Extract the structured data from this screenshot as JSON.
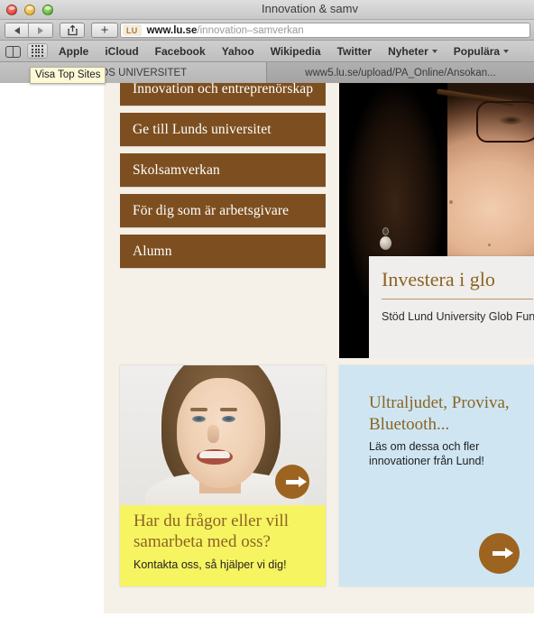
{
  "window": {
    "title": "Innovation & samv",
    "traffic_lights": [
      "close",
      "minimize",
      "zoom"
    ]
  },
  "toolbar": {
    "back_label": "Back",
    "forward_label": "Forward",
    "share_label": "Share",
    "new_tab_label": "+",
    "url_badge": "LU",
    "url_host": "www.lu.se",
    "url_path": "/innovation–samverkan"
  },
  "bookmarks_bar": {
    "sidebar_icon": "book-icon",
    "top_sites_icon": "grid-icon",
    "items": [
      {
        "label": "Apple",
        "has_menu": false
      },
      {
        "label": "iCloud",
        "has_menu": false
      },
      {
        "label": "Facebook",
        "has_menu": false
      },
      {
        "label": "Yahoo",
        "has_menu": false
      },
      {
        "label": "Wikipedia",
        "has_menu": false
      },
      {
        "label": "Twitter",
        "has_menu": false
      },
      {
        "label": "Nyheter",
        "has_menu": true
      },
      {
        "label": "Populära",
        "has_menu": true
      }
    ]
  },
  "tooltip": {
    "text": "Visa Top Sites"
  },
  "tabs": [
    {
      "label": "DS UNIVERSITET",
      "active": true
    },
    {
      "label": "www5.lu.se/upload/PA_Online/Ansokan...",
      "active": false
    }
  ],
  "page": {
    "nav_buttons": [
      {
        "label": "Innovation och entreprenörskap"
      },
      {
        "label": "Ge till Lunds universitet"
      },
      {
        "label": "Skolsamverkan"
      },
      {
        "label": "För dig som är arbetsgivare"
      },
      {
        "label": "Alumn"
      }
    ],
    "photo_card": {
      "caption_title": "Investera i glo",
      "caption_body": "Stöd Lund University Glob Fund"
    },
    "card_yellow": {
      "title": "Har du frågor eller vill samarbeta med oss?",
      "subtitle": "Kontakta oss, så hjälper vi dig!",
      "arrow": "arrow-right-icon"
    },
    "card_blue": {
      "title": "Ultraljudet, Proviva, Bluetooth...",
      "subtitle": "Läs om dessa och fler innovationer från Lund!",
      "arrow": "arrow-right-icon"
    }
  },
  "colors": {
    "nav_button_brown": "#7D4F20",
    "page_cream": "#F5F1E9",
    "card_yellow": "#F7F462",
    "card_blue": "#CFE6F2",
    "heading_gold": "#8A6424",
    "arrow_brown": "#9C6420"
  }
}
